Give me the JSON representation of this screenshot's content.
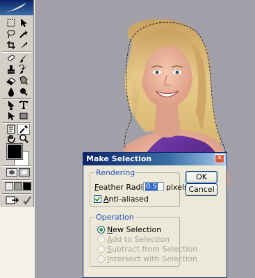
{
  "dialog": {
    "title": "Make Selection",
    "rendering": {
      "legend": "Rendering",
      "feather_label_prefix": "",
      "feather_label_ul": "F",
      "feather_label_rest": "eather Radius:",
      "feather_value": "0.5",
      "feather_unit": "pixels",
      "antialias_ul": "A",
      "antialias_rest": "nti-aliased",
      "antialias_checked": true
    },
    "operation": {
      "legend": "Operation",
      "options": [
        {
          "ul": "N",
          "rest": "ew Selection",
          "selected": true,
          "enabled": true
        },
        {
          "ul": "A",
          "rest": "dd to Selection",
          "selected": false,
          "enabled": false
        },
        {
          "ul": "S",
          "rest": "ubtract from Selection",
          "selected": false,
          "enabled": false
        },
        {
          "ul": "I",
          "rest": "ntersect with Selection",
          "selected": false,
          "enabled": false
        }
      ]
    },
    "ok_label": "OK",
    "cancel_label": "Cancel"
  },
  "toolbox": {
    "foreground_color": "#000000",
    "background_color": "#ffffff",
    "tools": [
      "marquee-icon",
      "move-icon",
      "lasso-icon",
      "magic-wand-icon",
      "crop-icon",
      "slice-icon",
      "healing-icon",
      "brush-icon",
      "stamp-icon",
      "history-brush-icon",
      "eraser-icon",
      "gradient-icon",
      "blur-icon",
      "dodge-icon",
      "pen-icon",
      "type-icon",
      "path-select-icon",
      "shape-icon",
      "notes-icon",
      "eyedropper-icon",
      "hand-icon",
      "zoom-icon"
    ]
  },
  "colors": {
    "accent": "#0a246a",
    "canvas_bg": "#a1a0a8"
  }
}
